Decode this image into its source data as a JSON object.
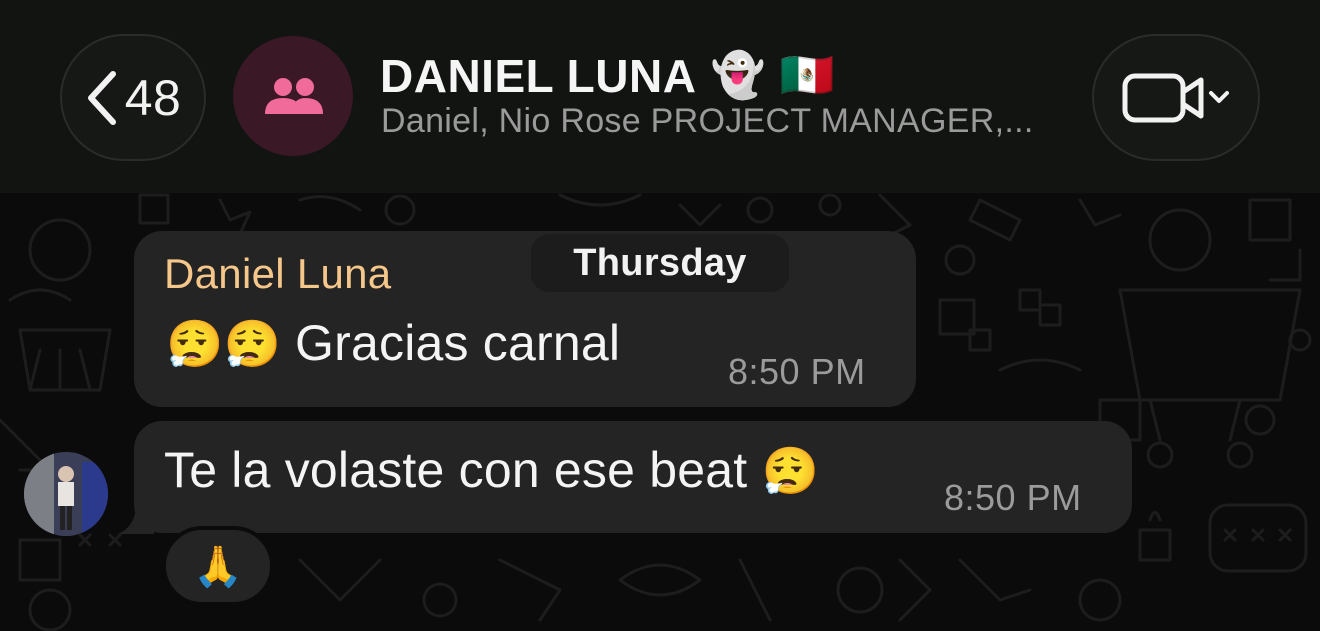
{
  "header": {
    "back_count": "48",
    "title": "DANIEL LUNA",
    "title_emojis": [
      "👻",
      "🇲🇽"
    ],
    "subtitle": "Daniel, Nio Rose PROJECT MANAGER,...",
    "group_icon": "group-people-icon",
    "call_icon": "video-camera-icon"
  },
  "day_separator": "Thursday",
  "messages": [
    {
      "sender": "Daniel Luna",
      "emojis": "😮‍💨😮‍💨",
      "text": "Gracias carnal",
      "time": "8:50 PM",
      "direction": "incoming"
    },
    {
      "text": "Te la volaste con ese beat",
      "emoji": "😮‍💨",
      "time": "8:50 PM",
      "direction": "incoming",
      "reaction": "🙏"
    }
  ],
  "colors": {
    "background": "#0b0b0b",
    "header": "#121412",
    "bubble": "#242424",
    "sender_name": "#f5c78a",
    "group_avatar_bg": "#3a1826",
    "group_icon": "#f06a9a",
    "timestamp": "#9b9b9b"
  }
}
